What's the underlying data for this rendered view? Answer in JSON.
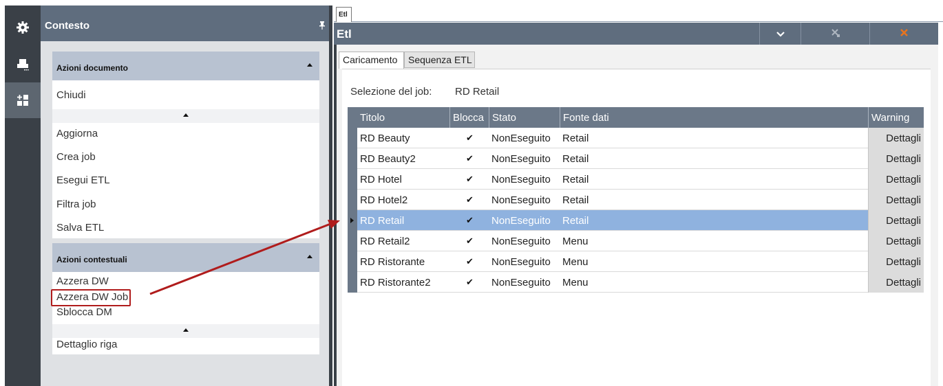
{
  "rail": {
    "items": [
      {
        "icon": "gear-icon"
      },
      {
        "icon": "printer-icon"
      },
      {
        "icon": "dashboard-add-icon"
      }
    ]
  },
  "context": {
    "title": "Contesto",
    "sections": [
      {
        "title": "Azioni documento",
        "items_top": [
          "Chiudi"
        ],
        "items_bottom": [
          "Aggiorna",
          "Crea job",
          "Esegui ETL",
          "Filtra job",
          "Salva ETL"
        ]
      },
      {
        "title": "Azioni contestuali",
        "items_top": [
          "Azzera DW",
          "Azzera DW Job",
          "Sblocca DM"
        ],
        "items_bottom": [
          "Dettaglio riga"
        ]
      }
    ]
  },
  "window": {
    "doc_tab": "Etl",
    "title": "Etl",
    "tabs": [
      "Caricamento",
      "Sequenza ETL"
    ],
    "active_tab": "Caricamento",
    "selection_label": "Selezione del job:",
    "selection_value": "RD Retail",
    "grid": {
      "columns": [
        "Titolo",
        "Blocca",
        "Stato",
        "Fonte dati",
        "Warning"
      ],
      "rows": [
        {
          "titolo": "RD Beauty",
          "blocca": "✔",
          "stato": "NonEseguito",
          "fonte": "Retail",
          "warning": "Dettagli"
        },
        {
          "titolo": "RD Beauty2",
          "blocca": "✔",
          "stato": "NonEseguito",
          "fonte": "Retail",
          "warning": "Dettagli"
        },
        {
          "titolo": "RD Hotel",
          "blocca": "✔",
          "stato": "NonEseguito",
          "fonte": "Retail",
          "warning": "Dettagli"
        },
        {
          "titolo": "RD Hotel2",
          "blocca": "✔",
          "stato": "NonEseguito",
          "fonte": "Retail",
          "warning": "Dettagli"
        },
        {
          "titolo": "RD Retail",
          "blocca": "✔",
          "stato": "NonEseguito",
          "fonte": "Retail",
          "warning": "Dettagli"
        },
        {
          "titolo": "RD Retail2",
          "blocca": "✔",
          "stato": "NonEseguito",
          "fonte": "Menu",
          "warning": "Dettagli"
        },
        {
          "titolo": "RD Ristorante",
          "blocca": "✔",
          "stato": "NonEseguito",
          "fonte": "Menu",
          "warning": "Dettagli"
        },
        {
          "titolo": "RD Ristorante2",
          "blocca": "✔",
          "stato": "NonEseguito",
          "fonte": "Menu",
          "warning": "Dettagli"
        }
      ],
      "selected_row": "RD Retail"
    }
  },
  "colors": {
    "header_bg": "#5f6d7e",
    "rail_bg": "#3a4047",
    "selected_row": "#8fb2df",
    "close_x": "#e8741e",
    "annotation": "#b01c1c"
  }
}
